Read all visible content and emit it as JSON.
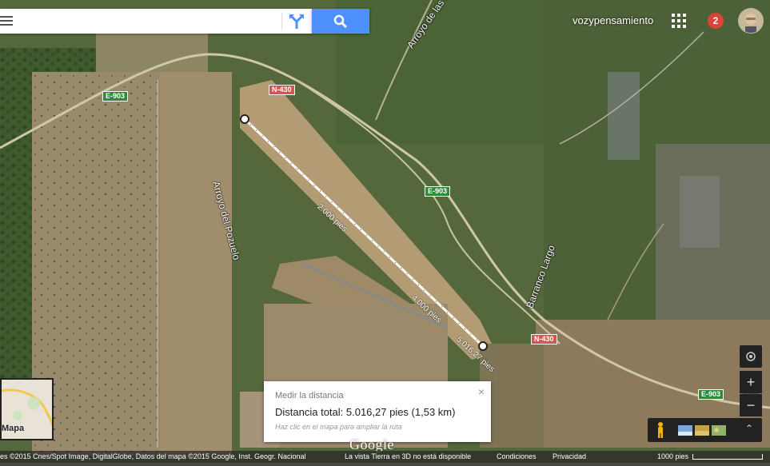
{
  "search": {
    "placeholder": "",
    "value": ""
  },
  "account": {
    "username": "vozypensamiento",
    "notifications": "2"
  },
  "roads": {
    "e903_a": "E-903",
    "e903_b": "E-903",
    "e903_c": "E-903",
    "n430_a": "N-430",
    "n430_b": "N-430"
  },
  "places": {
    "arroyo_lastr": "Arroyo de las La",
    "arroyo_pozuelo": "Arroyo del Pozuelo",
    "barranco_largo": "Barranco Largo"
  },
  "measure_path": {
    "label_2000": "2.000 pies",
    "label_4000": "4.000 pies",
    "label_end": "5.016,27 pies"
  },
  "measure_card": {
    "title": "Medir la distancia",
    "total": "Distancia total: 5.016,27 pies (1,53 km)",
    "hint": "Haz clic en el mapa para ampliar la ruta",
    "close": "×"
  },
  "minimap": {
    "label": "Mapa"
  },
  "controls": {
    "zoom_in": "+",
    "zoom_out": "−",
    "expand": "⌃"
  },
  "footer": {
    "credits": "es ©2015 Cnes/Spot Image, DigitalGlobe, Datos del mapa ©2015 Google, Inst. Geogr. Nacional",
    "earth3d": "La vista Tierra en 3D no está disponible",
    "terms": "Condiciones",
    "privacy": "Privacidad",
    "scale": "1000 pies"
  },
  "logo": "Google",
  "colors": {
    "search_blue": "#4d90fe",
    "notif_red": "#db4437",
    "road_green": "#2e8b3e",
    "road_red": "#d9534f"
  }
}
